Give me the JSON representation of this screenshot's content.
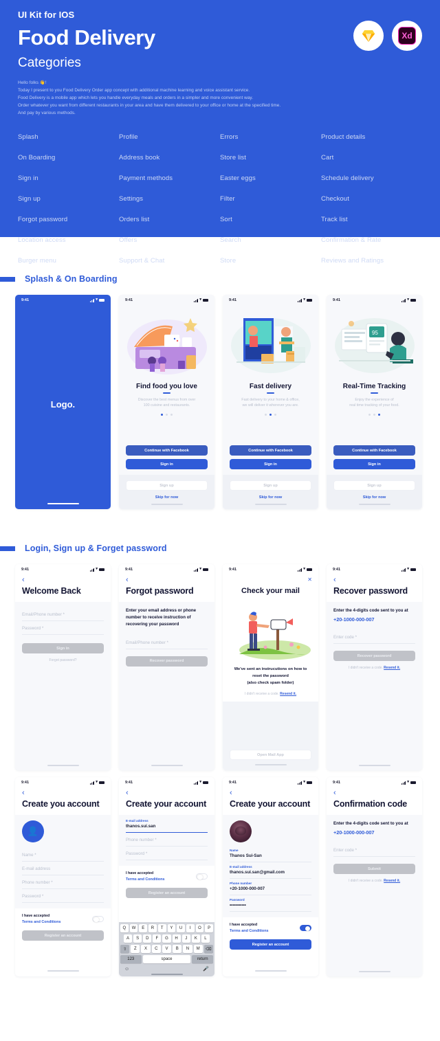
{
  "hero": {
    "kicker": "UI Kit for IOS",
    "title": "Food Delivery",
    "subtitle": "Categories",
    "accent_color": "#2f5bd8",
    "description_lines": [
      "Hello folks 👋!",
      "Today I present to you Food Delivery Order app concept with additional machine learning and voice assistant service.",
      "Food Delivery is a mobile app which lets you handle everyday meals and orders in a simpler and more convenient way.",
      "Order whatever you want from different restaurants in your area and have them delivered to your office or home at the specified time.",
      "And pay by various methods."
    ],
    "badges": [
      {
        "name": "sketch-logo",
        "label": ""
      },
      {
        "name": "adobe-xd-logo",
        "label": "Xd"
      }
    ],
    "categories": [
      "Splash",
      "Profile",
      "Errors",
      "Product details",
      "On Boarding",
      "Address book",
      "Store list",
      "Cart",
      "Sign in",
      "Payment methods",
      "Easter eggs",
      "Schedule delivery",
      "Sign up",
      "Settings",
      "Filter",
      "Checkout",
      "Forgot password",
      "Orders list",
      "Sort",
      "Track list",
      "Location access",
      "Offers",
      "Search",
      "Confirmation & Rate",
      "Burger menu",
      "Support & Chat",
      "Store",
      "Reviews and Ratings"
    ]
  },
  "status_bar": {
    "time": "9:41"
  },
  "section_splash": {
    "title": "Splash & On Boarding",
    "splash": {
      "logo": "Logo."
    },
    "onboarding": [
      {
        "title": "Find food you love",
        "desc": "Discover the best menus from over\n100 cuisine and restaurants.",
        "active_dot": 0,
        "facebook": "Continue with Facebook",
        "signin": "Sign in",
        "signup": "Sign up",
        "skip": "Skip for now"
      },
      {
        "title": "Fast delivery",
        "desc": "Fast delivery to your home & office,\nwe will deliver it wherever you are.",
        "active_dot": 1,
        "facebook": "Continue with Facebook",
        "signin": "Sign in",
        "signup": "Sign up",
        "skip": "Skip for now"
      },
      {
        "title": "Real-Time Tracking",
        "desc": "Enjoy the experience of\nreal time tracking of your food.",
        "active_dot": 2,
        "facebook": "Continue with Facebook",
        "signin": "Sign in",
        "signup": "Sign up",
        "skip": "Skip for now"
      }
    ]
  },
  "section_login": {
    "title": "Login, Sign up & Forget password",
    "welcome_back": {
      "title": "Welcome Back",
      "field_email": "Email/Phone number *",
      "field_password": "Password *",
      "signin_button": "Sign in",
      "forgot_link": "Forgot password?"
    },
    "forgot_password": {
      "title": "Forgot password",
      "desc": "Enter your email address or phone number to receive instruction of recovering your password",
      "field_email": "Email/Phone number *",
      "recover_button": "Recover password"
    },
    "check_mail": {
      "title": "Check your mail",
      "copy": "We've sent an instrucutions on how to\nreset the password\n(also check spam folder)",
      "resend_pre": "I didn't receive a code. ",
      "resend_link": "Resend it.",
      "open_mail_button": "Open Mail App"
    },
    "recover_password": {
      "title": "Recover password",
      "desc": "Enter the 4-digits code sent to you at",
      "phone": "+20-1000-000-007",
      "field_code": "Enter code *",
      "button": "Recover password",
      "resend_pre": "I didn't receive a code. ",
      "resend_link": "Resend it."
    },
    "create_account_empty": {
      "title": "Create you account",
      "avatar_icon": "add-person-icon",
      "field_name": "Name *",
      "field_email": "E-mail address",
      "field_phone": "Phone number *",
      "field_password": "Password *",
      "terms_line1": "I have accepted",
      "terms_line2": "Terms and Conditions",
      "toggle_on": false,
      "register_button": "Register an account"
    },
    "create_account_typing": {
      "title": "Create your account",
      "email_label": "E-mail address",
      "email_value": "thanos.sui.san",
      "field_phone": "Phone number *",
      "field_password": "Password *",
      "terms_line1": "I have accepted",
      "terms_line2": "Terms and Conditions",
      "toggle_on": false,
      "register_button": "Register an account",
      "keyboard": {
        "row1": [
          "Q",
          "W",
          "E",
          "R",
          "T",
          "Y",
          "U",
          "I",
          "O",
          "P"
        ],
        "row2": [
          "A",
          "S",
          "D",
          "F",
          "G",
          "H",
          "J",
          "K",
          "L"
        ],
        "row3": [
          "⇧",
          "Z",
          "X",
          "C",
          "V",
          "B",
          "N",
          "M",
          "⌫"
        ],
        "row4": [
          "123",
          "space",
          "return"
        ],
        "emoji": "☺",
        "mic": "🎤"
      }
    },
    "create_account_filled": {
      "title": "Create your account",
      "avatar": "user-photo",
      "name_label": "Name",
      "name_value": "Thanos Sui-San",
      "email_label": "E-mail address",
      "email_value": "thanos.sui.san@gmail.com",
      "phone_label": "Phone number",
      "phone_value": "+20-1000-000-007",
      "password_label": "Password",
      "password_value": "•••••••••••",
      "terms_line1": "I have accepted",
      "terms_line2": "Terms and Conditions",
      "toggle_on": true,
      "register_button": "Register an account"
    },
    "confirmation_code": {
      "title": "Confirmation code",
      "desc": "Enter the 4-digits code sent to you at",
      "phone": "+20-1000-000-007",
      "field_code": "Enter code *",
      "button": "Submit",
      "resend_pre": "I didn't receive a code. ",
      "resend_link": "Resend it."
    }
  }
}
